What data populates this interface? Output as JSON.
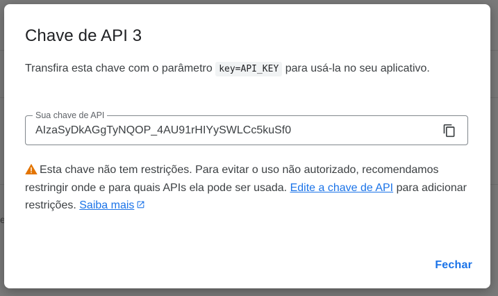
{
  "background": {
    "partial_text": "er"
  },
  "dialog": {
    "title": "Chave de API 3",
    "description": {
      "before": "Transfira esta chave com o parâmetro ",
      "code": "key=API_KEY",
      "after": " para usá-la no seu aplicativo."
    },
    "key_field": {
      "label": "Sua chave de API",
      "value": "AIzaSyDkAGgTyNQOP_4AU91rHIYySWLCc5kuSf0"
    },
    "warning": {
      "text": "Esta chave não tem restrições. Para evitar o uso não autorizado, recomendamos restringir onde e para quais APIs ela pode ser usada. ",
      "edit_link": "Edite a chave de API",
      "middle": " para adicionar restrições. ",
      "learn_more_link": "Saiba mais"
    },
    "close_label": "Fechar"
  },
  "colors": {
    "accent": "#1a73e8",
    "warning": "#e37400",
    "scrim": "#7a7a7a"
  },
  "icons": {
    "copy": "copy-icon",
    "warning": "warning-icon",
    "external": "external-link-icon"
  }
}
